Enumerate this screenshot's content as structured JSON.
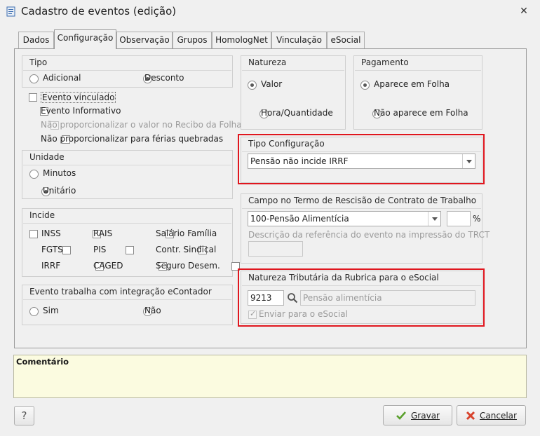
{
  "window": {
    "title": "Cadastro de eventos (edição)"
  },
  "tabs": [
    "Dados",
    "Configuração",
    "Observação",
    "Grupos",
    "HomologNet",
    "Vinculação",
    "eSocial"
  ],
  "active_tab": "Configuração",
  "tipo": {
    "title": "Tipo",
    "options": [
      {
        "label": "Adicional",
        "selected": false
      },
      {
        "label": "Desconto",
        "selected": true
      }
    ]
  },
  "checks": [
    {
      "label": "Evento vinculado",
      "checked": false,
      "enabled": true
    },
    {
      "label": "Evento Informativo",
      "checked": false,
      "enabled": true
    },
    {
      "label": "Não proporcionalizar o valor no Recibo da Folha",
      "checked": false,
      "enabled": false
    },
    {
      "label": "Não proporcionalizar para férias quebradas",
      "checked": false,
      "enabled": true
    }
  ],
  "unidade": {
    "title": "Unidade",
    "options": [
      {
        "label": "Minutos",
        "selected": false
      },
      {
        "label": "Unitário",
        "selected": true
      }
    ]
  },
  "incide": {
    "title": "Incide",
    "items": [
      "INSS",
      "RAIS",
      "Salário Família",
      "FGTS",
      "PIS",
      "Contr. Sindical",
      "IRRF",
      "CAGED",
      "Seguro Desem."
    ]
  },
  "econtador": {
    "title": "Evento trabalha com integração eContador",
    "options": [
      {
        "label": "Sim",
        "selected": false
      },
      {
        "label": "Não",
        "selected": false
      }
    ]
  },
  "natureza": {
    "title": "Natureza",
    "options": [
      {
        "label": "Valor",
        "selected": true
      },
      {
        "label": "Hora/Quantidade",
        "selected": false
      }
    ]
  },
  "pagamento": {
    "title": "Pagamento",
    "options": [
      {
        "label": "Aparece em Folha",
        "selected": true
      },
      {
        "label": "Não aparece em Folha",
        "selected": false
      }
    ]
  },
  "tipo_config": {
    "title": "Tipo Configuração",
    "value": "Pensão não incide IRRF"
  },
  "rescisao": {
    "title": "Campo no Termo de Rescisão de Contrato de Trabalho",
    "value": "100-Pensão Alimentícia",
    "percent_symbol": "%",
    "descricao_label": "Descrição da referência do evento na impressão do TRCT"
  },
  "natureza_trib": {
    "title": "Natureza Tributária da Rubrica para o eSocial",
    "code": "9213",
    "description": "Pensão alimentícia",
    "enviar_label": "Enviar para o eSocial",
    "enviar_checked": true
  },
  "comment": {
    "label": "Comentário"
  },
  "buttons": {
    "help": "?",
    "save": "Gravar",
    "cancel": "Cancelar"
  },
  "colors": {
    "highlight": "#e0161e",
    "comment_bg": "#fbfbe0"
  }
}
